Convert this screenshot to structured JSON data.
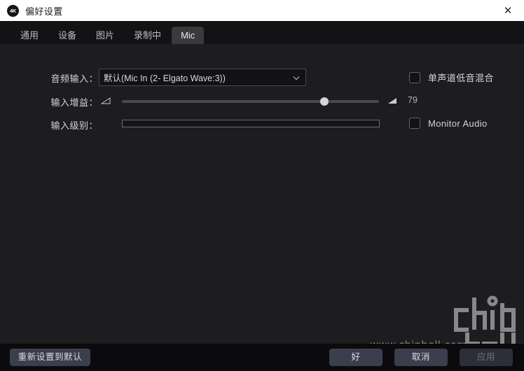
{
  "window": {
    "title": "偏好设置",
    "app_icon": "4K",
    "close_icon": "✕"
  },
  "tabs": [
    {
      "label": "通用",
      "active": false
    },
    {
      "label": "设备",
      "active": false
    },
    {
      "label": "图片",
      "active": false
    },
    {
      "label": "录制中",
      "active": false
    },
    {
      "label": "Mic",
      "active": true
    }
  ],
  "form": {
    "audio_input": {
      "label": "音频输入：",
      "value": "默认(Mic In (2- Elgato Wave:3))",
      "arrow_icon": "chevron-down-icon"
    },
    "input_gain": {
      "label": "输入增益：",
      "value": "79",
      "percent": 79,
      "low_icon": "volume-low-icon",
      "high_icon": "volume-high-icon"
    },
    "input_level": {
      "label": "输入级别：",
      "percent": 0
    }
  },
  "options": [
    {
      "label": "单声道低音混合",
      "checked": false
    },
    {
      "label": "Monitor Audio",
      "checked": false
    }
  ],
  "buttons": {
    "reset": "重新设置到默认",
    "ok": "好",
    "cancel": "取消",
    "apply": "应用"
  },
  "watermark": {
    "url": "www.chiphell.com",
    "logo": "chiphell"
  },
  "colors": {
    "titlebar_bg": "#ffffff",
    "content_bg": "#1d1d20",
    "tabstrip_bg": "#131316",
    "active_tab_bg": "#3a3a3d",
    "button_bg": "#3b3e4d",
    "text": "#d3d5da",
    "accent_value": "#a9b4c6"
  }
}
